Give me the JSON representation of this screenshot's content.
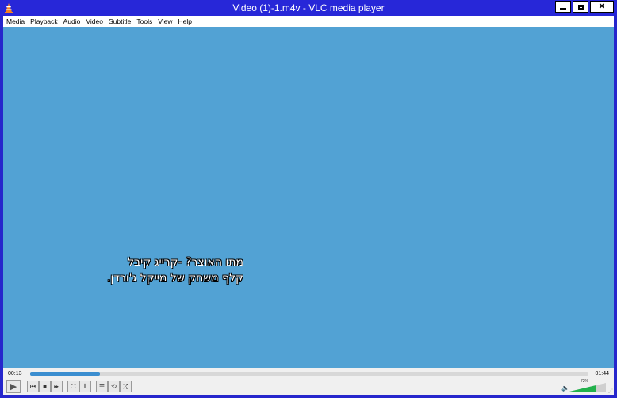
{
  "window": {
    "title": "Video (1)-1.m4v - VLC media player",
    "accent": "#2727d8"
  },
  "menu": {
    "items": [
      "Media",
      "Playback",
      "Audio",
      "Video",
      "Subtitle",
      "Tools",
      "View",
      "Help"
    ]
  },
  "video": {
    "background": "#52a2d4",
    "subtitle_lines": [
      "מתו האוצר? -קרייג קיבל",
      "קלף משחק של מייקל ג'ורדן."
    ]
  },
  "controls": {
    "elapsed": "00:13",
    "total": "01:44",
    "progress_fraction": 0.125,
    "volume_label": "72%",
    "volume_fraction": 0.72,
    "icons": [
      "play-icon",
      "previous-icon",
      "stop-icon",
      "next-icon",
      "fullscreen-icon",
      "extended-settings-icon",
      "playlist-icon",
      "loop-icon",
      "shuffle-icon",
      "speaker-icon"
    ]
  }
}
